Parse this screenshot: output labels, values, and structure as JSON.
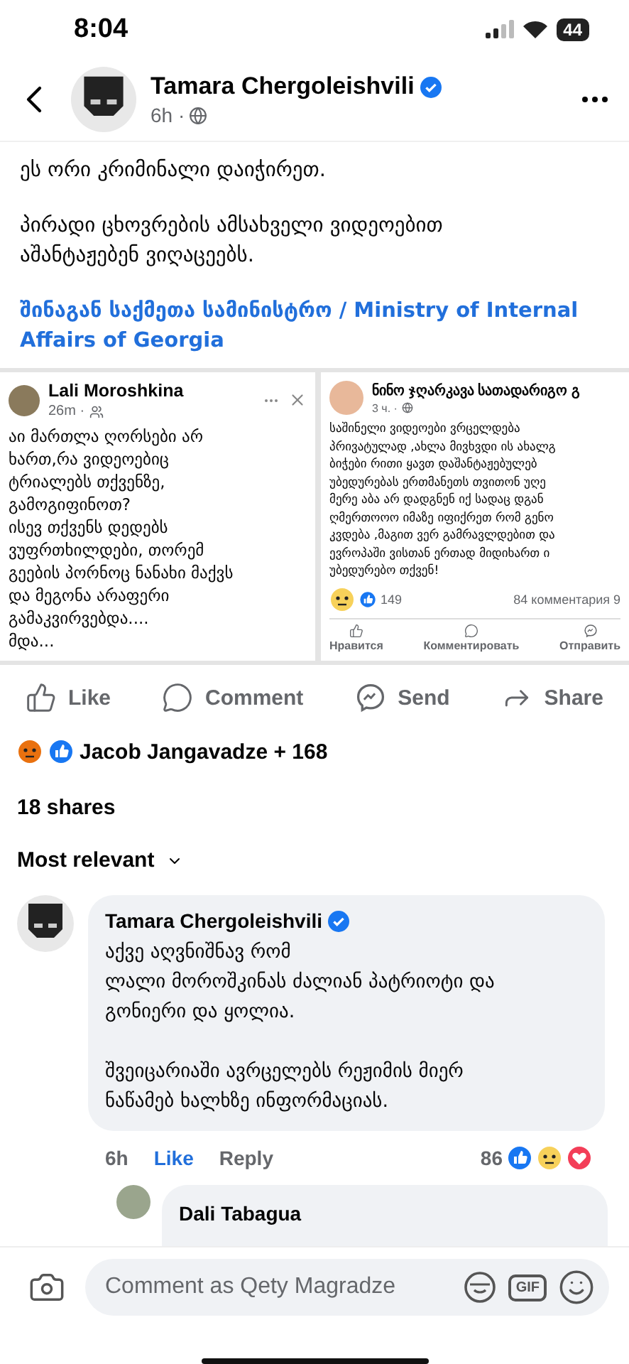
{
  "status_bar": {
    "time": "8:04",
    "battery": "44"
  },
  "post": {
    "author": "Tamara Chergoleishvili",
    "verified": true,
    "time": "6h ·",
    "paragraphs": [
      "ეს ორი კრიმინალი დაიჭირეთ.",
      "პირადი ცხოვრების ამსახველი ვიდეოებით\nაშანტაჟებენ ვიღაცეებს."
    ],
    "link": "შინაგან საქმეთა სამინისტრო / Ministry of Internal Affairs of Georgia"
  },
  "left_card": {
    "author": "Lali Moroshkina",
    "time": "26m ·",
    "text": "აი მართლა ღორსები არ\nხართ,რა ვიდეოებიც\nტრიალებს თქვენზე,\nგამოგიფინოთ?\nისევ  თქვენს დედებს\nვუფრთხილდები, თორემ\nგეების პორნოც ნანახი მაქვს\nდა მეგონა არაფერი\nგამაკვირვებდა....\nმდა..."
  },
  "right_card": {
    "author": "ნინო ჯღარკავა სათადარიგო გ",
    "time": "3 ч. ·",
    "lines": [
      "საშინელი ვიდეოები  ვრცელდება",
      "პრივატულად ,ახლა მივხვდი ის ახალგ",
      "ბიჭები რითი  ყავთ დაშანტაჟებულებ",
      "უბედურებას ერთმანეთს თვითონ უღე",
      "მერე აბა არ დადგნენ იქ სადაც დგან",
      "ღმერთოოო იმაზე იფიქრეთ რომ გენო",
      "კვდება ,მაგით ვერ გამრავლდებით და",
      "ევროპაში ვისთან ერთად მიდიხართ ი",
      "უბედურებო თქვენ!"
    ],
    "reactions": "149",
    "comments": "84 комментария 9",
    "actions": [
      {
        "kind": "like",
        "label": "Нравится"
      },
      {
        "kind": "comment",
        "label": "Комментировать"
      },
      {
        "kind": "send",
        "label": "Отправить"
      }
    ]
  },
  "actions": [
    {
      "kind": "like",
      "label": "Like"
    },
    {
      "kind": "comment",
      "label": "Comment"
    },
    {
      "kind": "send",
      "label": "Send"
    },
    {
      "kind": "share",
      "label": "Share"
    }
  ],
  "reactions": "Jacob Jangavadze + 168",
  "shares": "18 shares",
  "sort": "Most relevant",
  "comment": {
    "author": "Tamara Chergoleishvili",
    "verified": true,
    "text": "აქვე აღვნიშნავ რომ\nლალი მოროშკინას ძალიან პატრიოტი და\nგონიერი და ყოლია.\n\nშვეიცარიაში ავრცელებს რეჟიმის მიერ\nნაწამებ ხალხზე ინფორმაციას.",
    "time": "6h",
    "like": "Like",
    "liked": true,
    "reply": "Reply",
    "count": "86"
  },
  "reply": {
    "author": "Dali Tabagua"
  },
  "composer": {
    "placeholder": "Comment as Qety Magradze",
    "gif": "GIF"
  }
}
